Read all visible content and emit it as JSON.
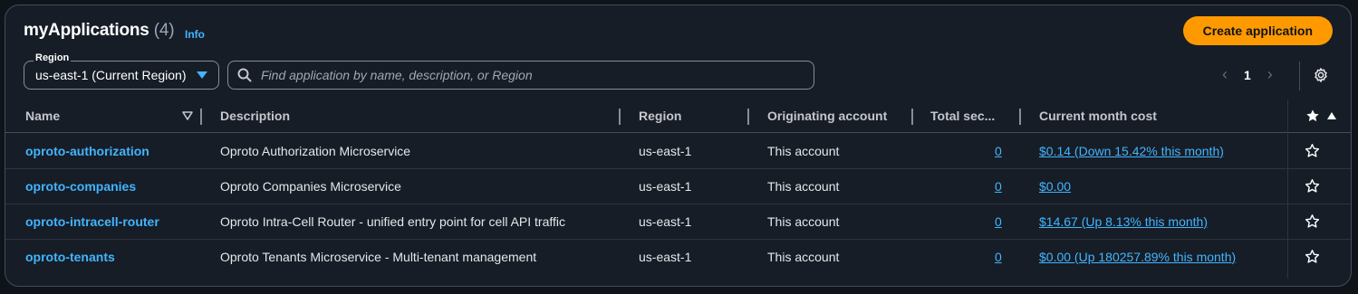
{
  "header": {
    "title": "myApplications",
    "count": "(4)",
    "info_label": "Info",
    "create_button": "Create application"
  },
  "filters": {
    "region_label": "Region",
    "region_value": "us-east-1 (Current Region)",
    "search_placeholder": "Find application by name, description, or Region"
  },
  "pagination": {
    "current_page": "1",
    "prev_icon": "chevron-left-icon",
    "next_icon": "chevron-right-icon"
  },
  "table": {
    "columns": {
      "name": "Name",
      "description": "Description",
      "region": "Region",
      "originating_account": "Originating account",
      "total_security": "Total sec...",
      "cost": "Current month cost"
    },
    "rows": [
      {
        "name": "oproto-authorization",
        "description": "Oproto Authorization Microservice",
        "region": "us-east-1",
        "account": "This account",
        "security": "0",
        "cost": "$0.14 (Down 15.42% this month)"
      },
      {
        "name": "oproto-companies",
        "description": "Oproto Companies Microservice",
        "region": "us-east-1",
        "account": "This account",
        "security": "0",
        "cost": "$0.00"
      },
      {
        "name": "oproto-intracell-router",
        "description": "Oproto Intra-Cell Router - unified entry point for cell API traffic",
        "region": "us-east-1",
        "account": "This account",
        "security": "0",
        "cost": "$14.67 (Up 8.13% this month)"
      },
      {
        "name": "oproto-tenants",
        "description": "Oproto Tenants Microservice - Multi-tenant management",
        "region": "us-east-1",
        "account": "This account",
        "security": "0",
        "cost": "$0.00 (Up 180257.89% this month)"
      }
    ]
  },
  "colors": {
    "accent": "#42b4ff",
    "primary_button": "#ff9900",
    "background": "#161d26"
  }
}
